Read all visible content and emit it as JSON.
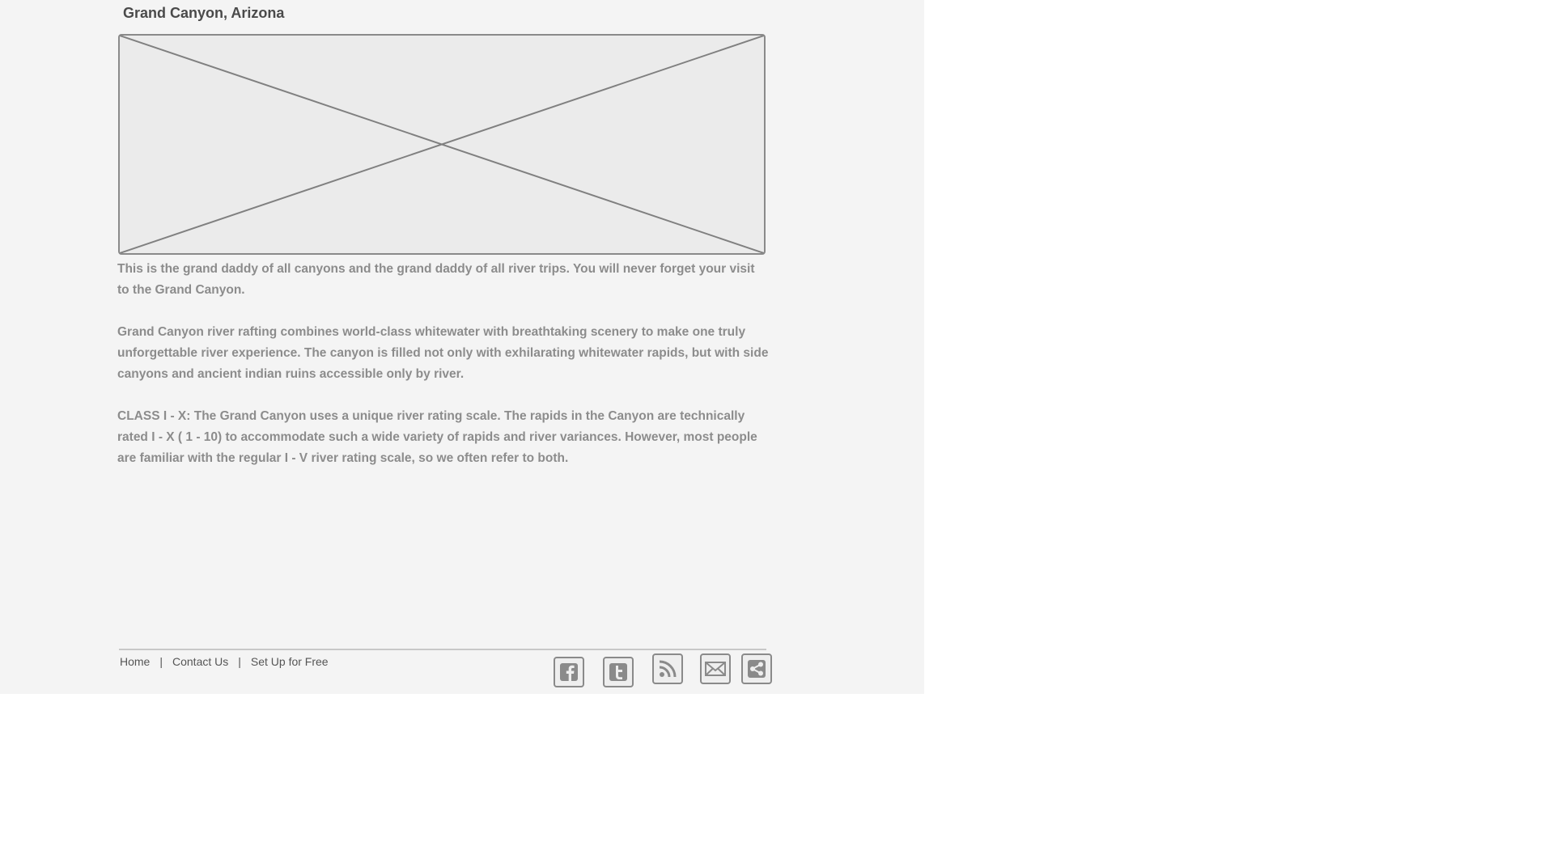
{
  "page": {
    "title": "Grand Canyon, Arizona",
    "hero_image": {
      "icon": "image-placeholder-icon"
    },
    "paragraphs": [
      "This is the grand daddy of all canyons and the grand daddy of all river trips. You will never forget your visit to the Grand Canyon.",
      "Grand Canyon river rafting combines world-class whitewater with breathtaking scenery to make one truly unforgettable river experience. The canyon is filled not only with exhilarating whitewater rapids, but with side canyons and ancient indian ruins accessible only by river.",
      "CLASS I - X: The Grand Canyon uses a unique river rating scale. The rapids in the Canyon are technically rated I - X ( 1 - 10) to accommodate such a wide variety of rapids and river variances. However, most people are familiar with the regular I - V river rating scale, so we often refer to both."
    ]
  },
  "footer": {
    "links": {
      "home": "Home",
      "contact": "Contact Us",
      "setup": "Set Up for Free"
    },
    "separator": "|",
    "social_icons": [
      "facebook-icon",
      "twitter-icon",
      "rss-icon",
      "email-icon",
      "share-icon"
    ]
  },
  "colors": {
    "page_background": "#f4f4f4",
    "text_muted": "#8c8c8c",
    "title_text": "#4a4a4a",
    "icon_stroke": "#8a8a8a",
    "placeholder_fill": "#ebebeb"
  }
}
